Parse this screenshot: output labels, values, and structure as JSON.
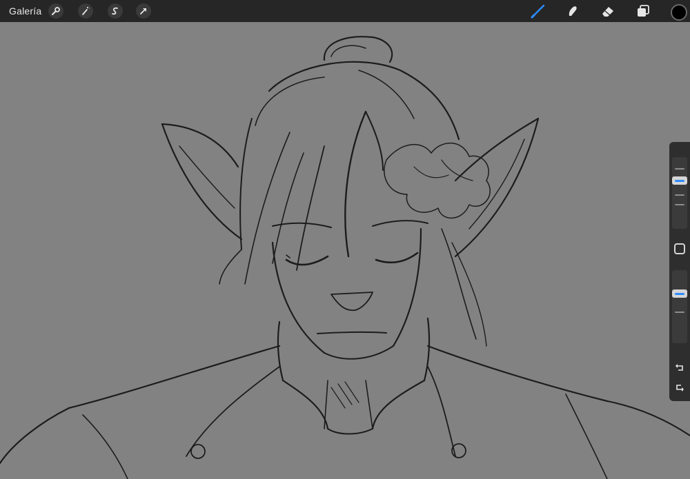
{
  "toolbar": {
    "gallery_label": "Galería",
    "left_icons": [
      "wrench-icon",
      "magic-wand-icon",
      "selection-icon",
      "transform-arrow-icon"
    ],
    "right_tools": [
      "brush-icon",
      "smudge-icon",
      "eraser-icon",
      "layers-icon"
    ],
    "active_tool": "brush",
    "accent_color": "#2d8cff",
    "current_color": "#000000"
  },
  "sidebar": {
    "brush_size_level": 0.3,
    "opacity_level": 0.75,
    "icons": [
      "modify-square-icon",
      "undo-icon",
      "redo-icon"
    ]
  },
  "canvas": {
    "background_color": "#828282",
    "stroke_color": "#1a1a1a"
  }
}
